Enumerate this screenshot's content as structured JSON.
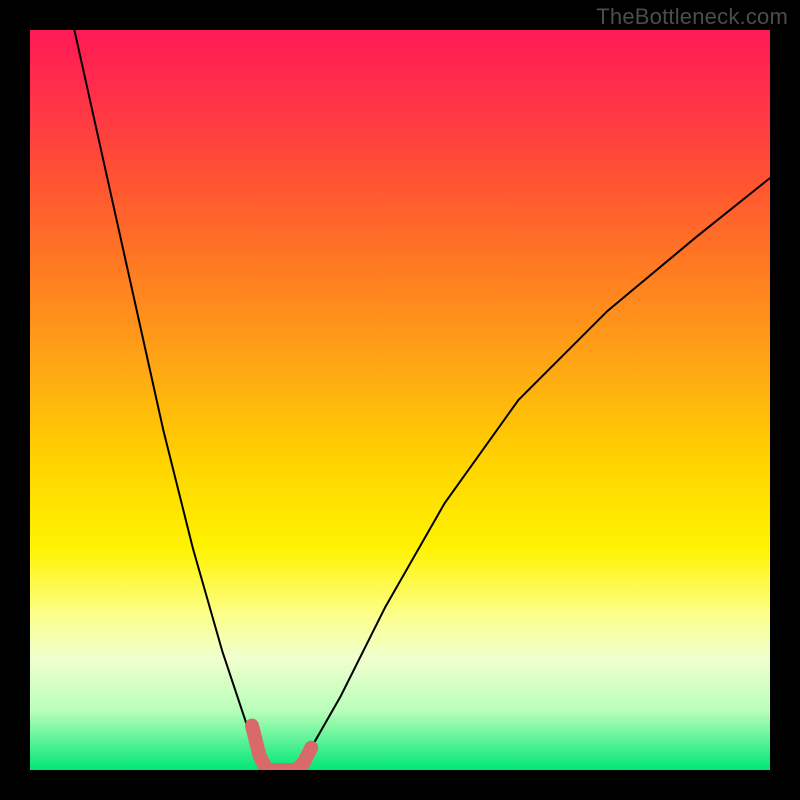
{
  "watermark": "TheBottleneck.com",
  "chart_data": {
    "type": "line",
    "title": "",
    "xlabel": "",
    "ylabel": "",
    "xlim": [
      0,
      100
    ],
    "ylim": [
      0,
      100
    ],
    "grid": false,
    "series": [
      {
        "name": "left-curve",
        "x": [
          6,
          10,
          14,
          18,
          22,
          26,
          28,
          30,
          31,
          32
        ],
        "y": [
          100,
          82,
          64,
          46,
          30,
          16,
          10,
          4,
          1,
          0
        ]
      },
      {
        "name": "right-curve",
        "x": [
          36,
          38,
          42,
          48,
          56,
          66,
          78,
          90,
          100
        ],
        "y": [
          0,
          3,
          10,
          22,
          36,
          50,
          62,
          72,
          80
        ]
      }
    ],
    "annotations": [
      {
        "name": "optimum-marker",
        "type": "polyline",
        "points_x": [
          30,
          31,
          32,
          34,
          36,
          37,
          38
        ],
        "points_y": [
          6,
          2,
          0,
          0,
          0,
          1,
          3
        ]
      }
    ],
    "background_gradient": {
      "top": "#ff1a55",
      "middle": "#fff300",
      "bottom": "#00e676"
    }
  }
}
